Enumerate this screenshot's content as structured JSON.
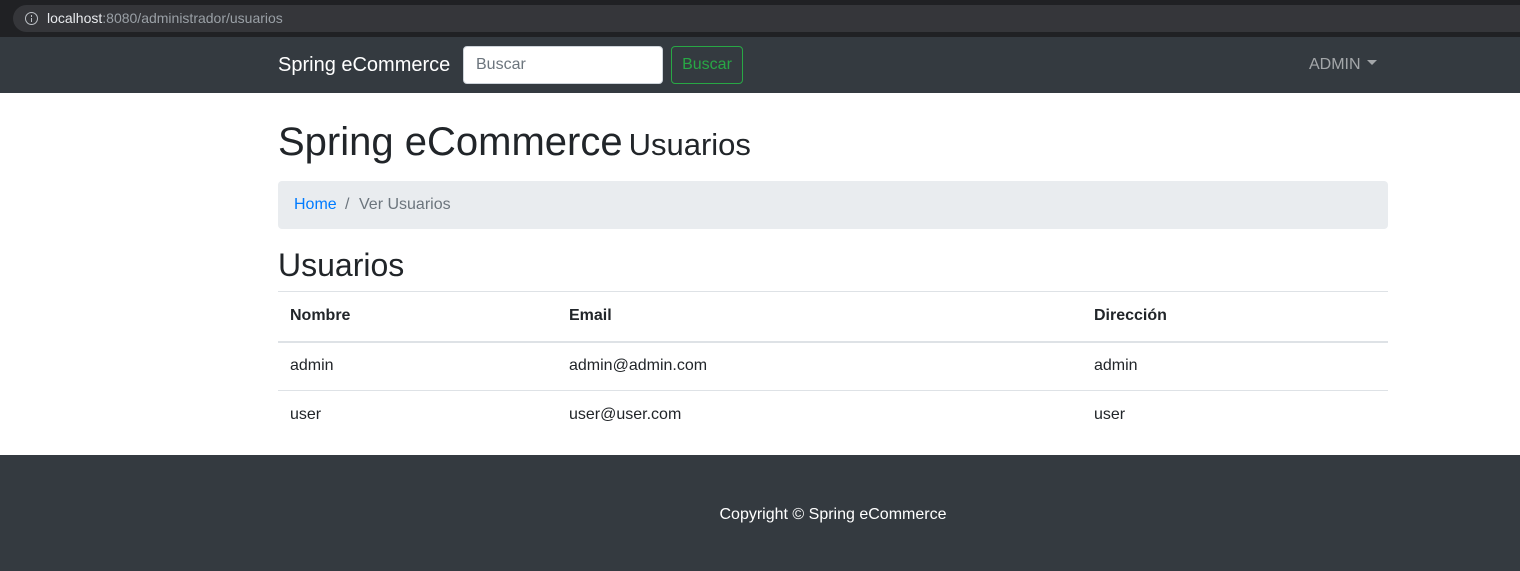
{
  "browser": {
    "url_host": "localhost",
    "url_rest": ":8080/administrador/usuarios"
  },
  "navbar": {
    "brand": "Spring eCommerce",
    "search_placeholder": "Buscar",
    "search_button": "Buscar",
    "user_menu": "ADMIN"
  },
  "header": {
    "title": "Spring eCommerce",
    "subtitle": "Usuarios"
  },
  "breadcrumb": {
    "home": "Home",
    "separator": "/",
    "active": "Ver Usuarios"
  },
  "section": {
    "title": "Usuarios"
  },
  "table": {
    "headers": [
      "Nombre",
      "Email",
      "Dirección"
    ],
    "rows": [
      [
        "admin",
        "admin@admin.com",
        "admin"
      ],
      [
        "user",
        "user@user.com",
        "user"
      ]
    ]
  },
  "footer": {
    "copyright": "Copyright © Spring eCommerce"
  },
  "colors": {
    "navbar_bg": "#343a40",
    "success": "#28a745",
    "link": "#007bff",
    "breadcrumb_bg": "#e9ecef"
  }
}
